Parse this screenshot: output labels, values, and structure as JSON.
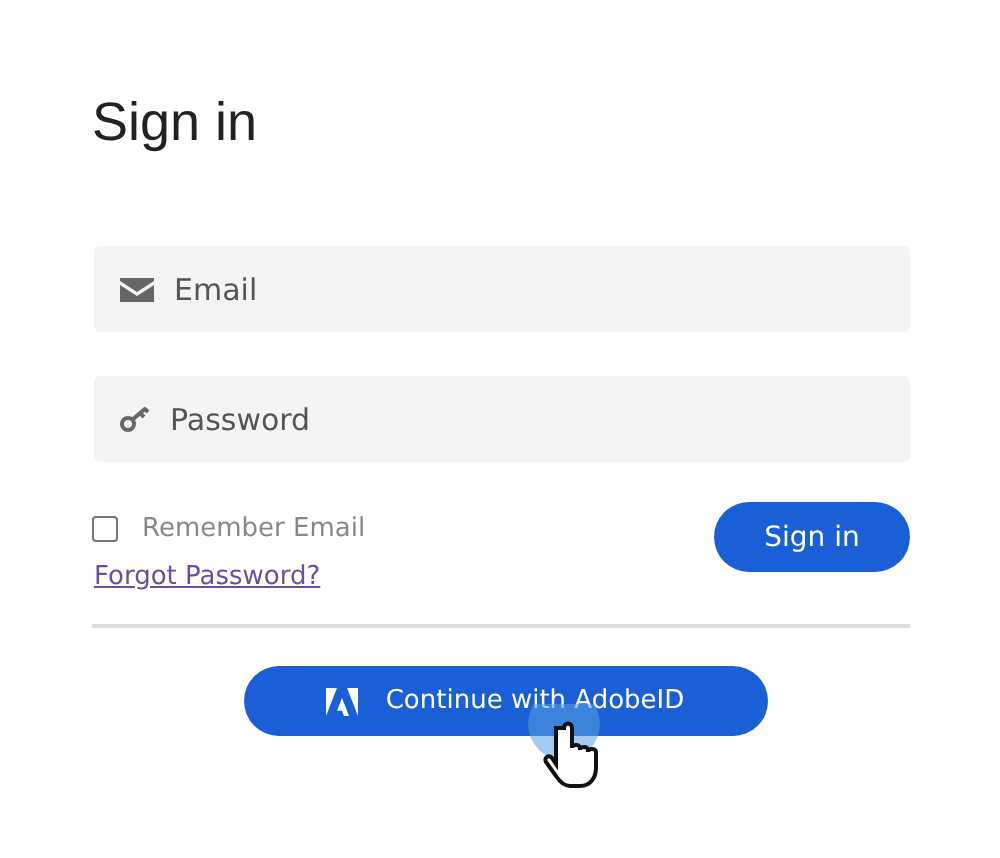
{
  "title": "Sign in",
  "fields": [
    {
      "kind": "email",
      "placeholder": "Email"
    },
    {
      "kind": "password",
      "placeholder": "Password"
    }
  ],
  "remember": {
    "label": "Remember Email",
    "checked": false
  },
  "sign_in_button": "Sign in",
  "forgot_link": "Forgot Password?",
  "adobe_button": "Continue with AdobeID"
}
